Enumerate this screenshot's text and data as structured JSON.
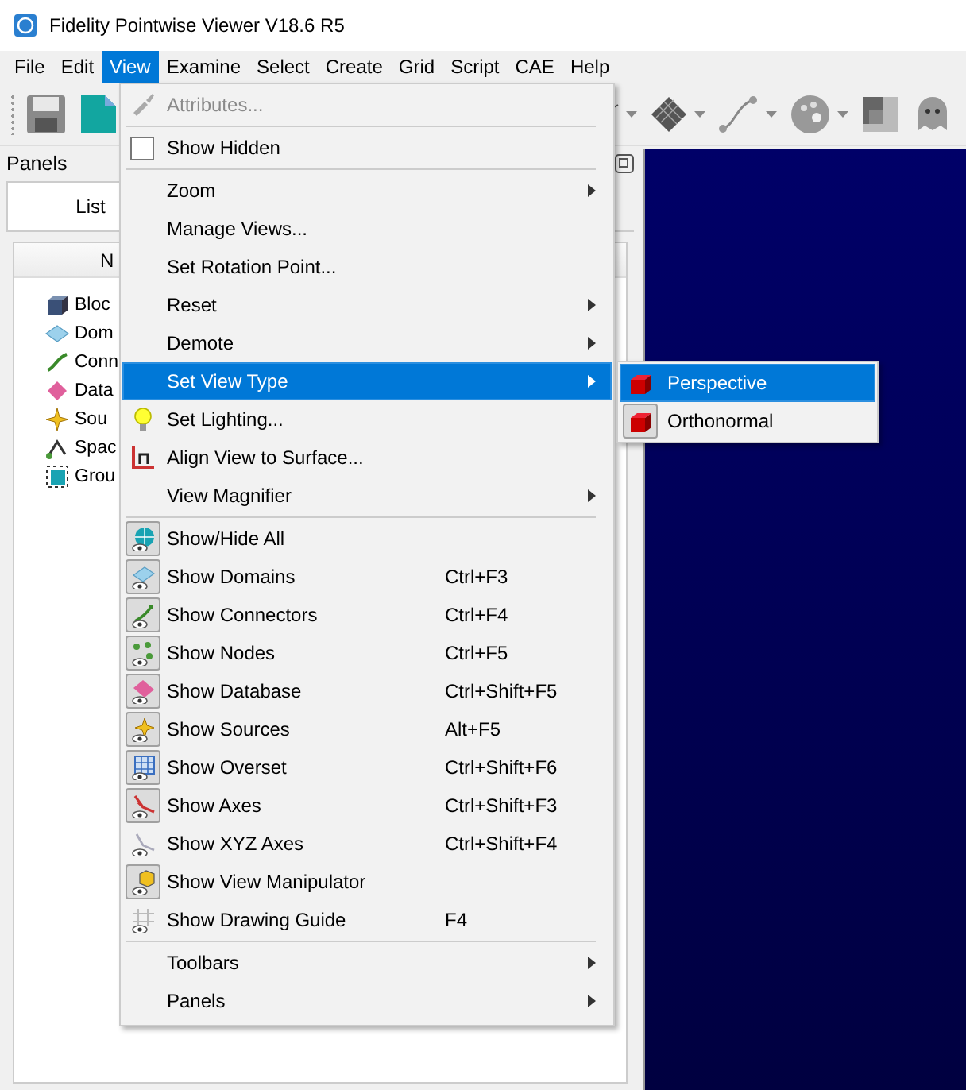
{
  "window": {
    "title": "Fidelity Pointwise Viewer V18.6 R5"
  },
  "menubar": [
    {
      "label": "File",
      "selected": false
    },
    {
      "label": "Edit",
      "selected": false
    },
    {
      "label": "View",
      "selected": true
    },
    {
      "label": "Examine",
      "selected": false
    },
    {
      "label": "Select",
      "selected": false
    },
    {
      "label": "Create",
      "selected": false
    },
    {
      "label": "Grid",
      "selected": false
    },
    {
      "label": "Script",
      "selected": false
    },
    {
      "label": "CAE",
      "selected": false
    },
    {
      "label": "Help",
      "selected": false
    }
  ],
  "panels": {
    "title": "Panels",
    "tabs": [
      {
        "label": "List",
        "selected": true
      }
    ],
    "tree_header": "N",
    "items": [
      {
        "label": "Bloc"
      },
      {
        "label": "Dom"
      },
      {
        "label": "Conn"
      },
      {
        "label": "Data"
      },
      {
        "label": "Sou"
      },
      {
        "label": "Spac"
      },
      {
        "label": "Grou"
      }
    ]
  },
  "view_menu": {
    "sections": [
      [
        {
          "kind": "item",
          "label": "Attributes...",
          "disabled": true,
          "selected": false,
          "submenu": false
        }
      ],
      [
        {
          "kind": "check",
          "label": "Show Hidden",
          "checked": false,
          "disabled": false,
          "selected": false,
          "submenu": false
        }
      ],
      [
        {
          "kind": "item",
          "label": "Zoom",
          "disabled": false,
          "selected": false,
          "submenu": true
        },
        {
          "kind": "item",
          "label": "Manage Views...",
          "disabled": false,
          "selected": false,
          "submenu": false
        },
        {
          "kind": "item",
          "label": "Set Rotation Point...",
          "disabled": false,
          "selected": false,
          "submenu": false
        },
        {
          "kind": "item",
          "label": "Reset",
          "disabled": false,
          "selected": false,
          "submenu": true
        },
        {
          "kind": "item",
          "label": "Demote",
          "disabled": false,
          "selected": false,
          "submenu": true
        },
        {
          "kind": "item",
          "label": "Set View Type",
          "disabled": false,
          "selected": true,
          "submenu": true
        },
        {
          "kind": "item",
          "label": "Set Lighting...",
          "disabled": false,
          "selected": false,
          "submenu": false
        },
        {
          "kind": "item",
          "label": "Align View to Surface...",
          "disabled": false,
          "selected": false,
          "submenu": false
        },
        {
          "kind": "item",
          "label": "View Magnifier",
          "disabled": false,
          "selected": false,
          "submenu": true
        }
      ],
      [
        {
          "kind": "toggle",
          "label": "Show/Hide All",
          "checked": true,
          "disabled": false,
          "selected": false,
          "submenu": false
        },
        {
          "kind": "toggle",
          "label": "Show Domains",
          "shortcut": "Ctrl+F3",
          "checked": true,
          "disabled": false,
          "selected": false,
          "submenu": false
        },
        {
          "kind": "toggle",
          "label": "Show Connectors",
          "shortcut": "Ctrl+F4",
          "checked": true,
          "disabled": false,
          "selected": false,
          "submenu": false
        },
        {
          "kind": "toggle",
          "label": "Show Nodes",
          "shortcut": "Ctrl+F5",
          "checked": true,
          "disabled": false,
          "selected": false,
          "submenu": false
        },
        {
          "kind": "toggle",
          "label": "Show Database",
          "shortcut": "Ctrl+Shift+F5",
          "checked": true,
          "disabled": false,
          "selected": false,
          "submenu": false
        },
        {
          "kind": "toggle",
          "label": "Show Sources",
          "shortcut": "Alt+F5",
          "checked": true,
          "disabled": false,
          "selected": false,
          "submenu": false
        },
        {
          "kind": "toggle",
          "label": "Show Overset",
          "shortcut": "Ctrl+Shift+F6",
          "checked": true,
          "disabled": false,
          "selected": false,
          "submenu": false
        },
        {
          "kind": "toggle",
          "label": "Show Axes",
          "shortcut": "Ctrl+Shift+F3",
          "checked": true,
          "disabled": false,
          "selected": false,
          "submenu": false
        },
        {
          "kind": "toggle",
          "label": "Show XYZ Axes",
          "shortcut": "Ctrl+Shift+F4",
          "checked": false,
          "disabled": false,
          "selected": false,
          "submenu": false
        },
        {
          "kind": "toggle",
          "label": "Show View Manipulator",
          "checked": true,
          "disabled": false,
          "selected": false,
          "submenu": false
        },
        {
          "kind": "toggle",
          "label": "Show Drawing Guide",
          "shortcut": "F4",
          "checked": false,
          "disabled": false,
          "selected": false,
          "submenu": false
        }
      ],
      [
        {
          "kind": "item",
          "label": "Toolbars",
          "disabled": false,
          "selected": false,
          "submenu": true
        },
        {
          "kind": "item",
          "label": "Panels",
          "disabled": false,
          "selected": false,
          "submenu": true
        }
      ]
    ],
    "view_type_submenu": [
      {
        "label": "Perspective",
        "selected": true,
        "checked": false
      },
      {
        "label": "Orthonormal",
        "selected": false,
        "checked": true
      }
    ]
  }
}
